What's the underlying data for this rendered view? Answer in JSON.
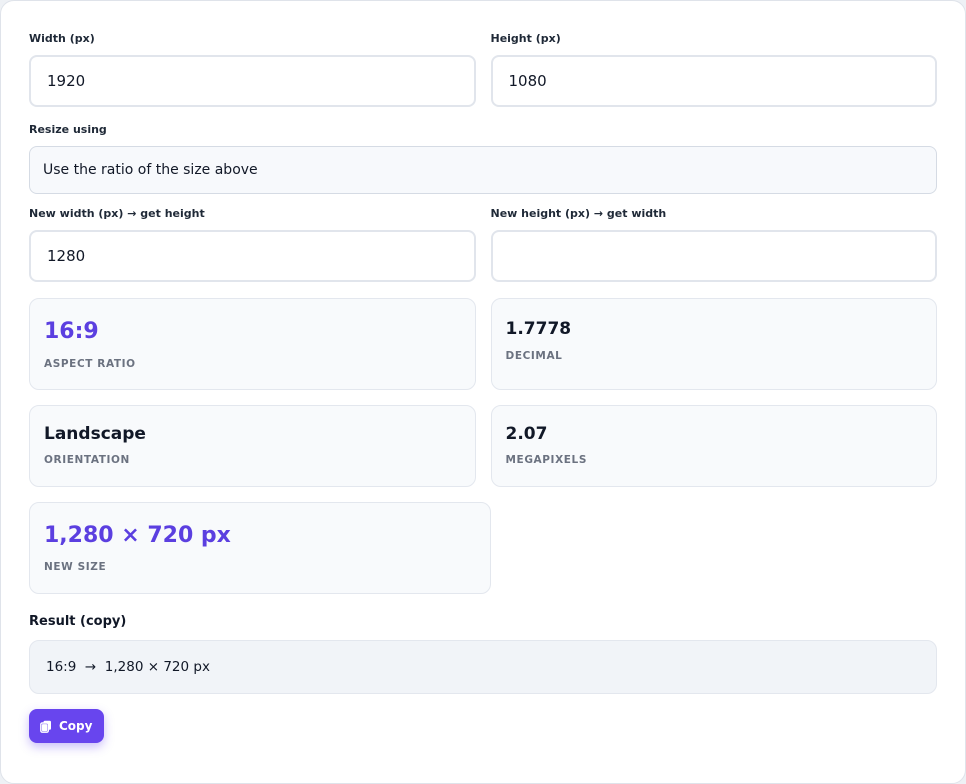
{
  "inputs": {
    "width": {
      "label": "Width (px)",
      "value": "1920"
    },
    "height": {
      "label": "Height (px)",
      "value": "1080"
    },
    "resize_using": {
      "label": "Resize using",
      "value": "Use the ratio of the size above"
    },
    "new_width": {
      "label": "New width (px) → get height",
      "value": "1280"
    },
    "new_height": {
      "label": "New height (px) → get width",
      "value": ""
    }
  },
  "stats": {
    "aspect_ratio": {
      "value": "16:9",
      "caption": "ASPECT RATIO"
    },
    "decimal": {
      "value": "1.7778",
      "caption": "DECIMAL"
    },
    "orientation": {
      "value": "Landscape",
      "caption": "ORIENTATION"
    },
    "megapixels": {
      "value": "2.07",
      "caption": "MEGAPIXELS"
    },
    "new_size": {
      "value": "1,280 × 720 px",
      "caption": "NEW SIZE"
    }
  },
  "result": {
    "label": "Result (copy)",
    "value": "16:9  →  1,280 × 720 px"
  },
  "copy_button": {
    "label": "Copy",
    "icon": "copy-icon"
  },
  "colors": {
    "accent": "#5b3fe0",
    "button": "#6845ee"
  }
}
